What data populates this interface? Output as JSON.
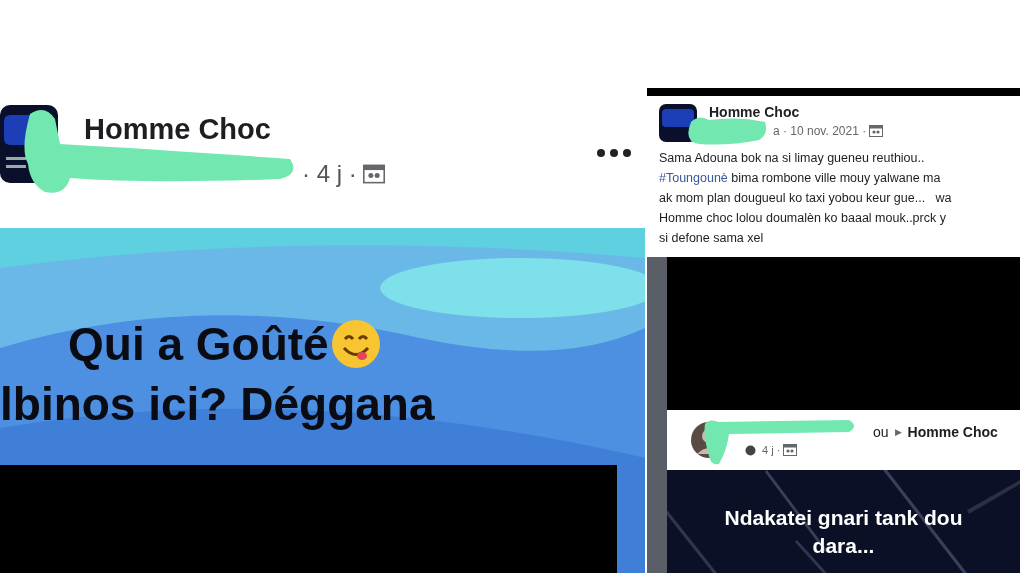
{
  "left_post": {
    "page_name": "Homme Choc",
    "meta": "· 4 j ·",
    "image_lines": [
      "Qui a Goûté",
      "lbinos ici? Déggana"
    ]
  },
  "right_post": {
    "page_name": "Homme Choc",
    "meta": "a · 10 nov. 2021 ·",
    "body_lines": [
      {
        "text": "Sama Adouna bok na si limay gueneu reuthiou.."
      },
      {
        "hashtag": "#Toungounè",
        "text": " bima rombone ville mouy yalwane ma"
      },
      {
        "text": "ak mom plan dougueul ko taxi yobou keur gue...   wa"
      },
      {
        "text": "Homme choc lolou doumalèn ko baaal mouk..prck y"
      },
      {
        "text": "si defone sama xel"
      }
    ]
  },
  "shared_post": {
    "author_tail": "ou",
    "arrow": "▶",
    "page_name": "Homme Choc",
    "meta": "4 j ·",
    "image_lines": [
      "Ndakatei gnari tank dou",
      "dara..."
    ]
  }
}
